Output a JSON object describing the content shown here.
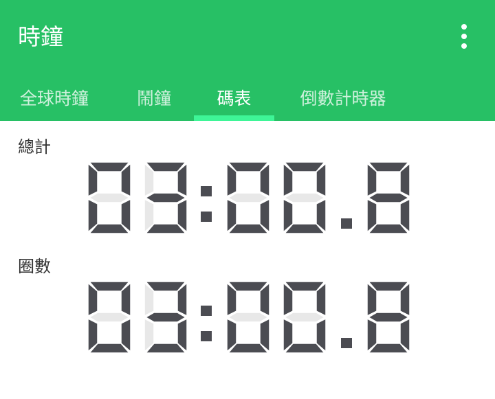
{
  "app": {
    "title": "時鐘",
    "menu_icon": "more-vert-icon"
  },
  "tabs": [
    {
      "label": "全球時鐘",
      "active": false
    },
    {
      "label": "鬧鐘",
      "active": false
    },
    {
      "label": "碼表",
      "active": true
    },
    {
      "label": "倒數計時器",
      "active": false
    }
  ],
  "stopwatch": {
    "total": {
      "label": "總計",
      "display": "03:00.8"
    },
    "lap": {
      "label": "圈數",
      "display": "03:00.8"
    }
  },
  "colors": {
    "primary": "#27c065",
    "tab_indicator": "#3ef597",
    "segment_on": "#4b4c52",
    "segment_off": "#e8e8e8"
  }
}
